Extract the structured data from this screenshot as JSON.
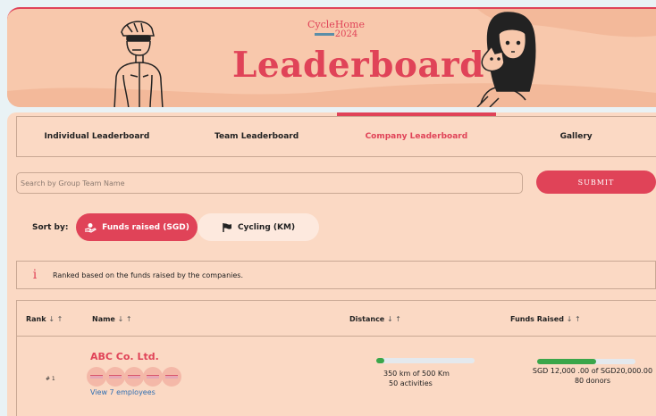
{
  "banner": {
    "logo_brand_a": "Cycle",
    "logo_brand_b": "Home",
    "logo_year": "2024",
    "title": "Leaderboard"
  },
  "tabs": [
    {
      "label": "Individual Leaderboard",
      "active": false
    },
    {
      "label": "Team Leaderboard",
      "active": false
    },
    {
      "label": "Company Leaderboard",
      "active": true
    },
    {
      "label": "Gallery",
      "active": false
    }
  ],
  "search": {
    "placeholder": "Search by Group Team Name",
    "submit_label": "SUBMIT"
  },
  "sort": {
    "label": "Sort by:",
    "options": [
      {
        "label": "Funds raised (SGD)",
        "icon": "donation-icon",
        "active": true
      },
      {
        "label": "Cycling (KM)",
        "icon": "flag-icon",
        "active": false
      }
    ]
  },
  "info": {
    "icon": "i",
    "text": "Ranked based on the funds raised by the companies."
  },
  "table": {
    "headers": {
      "rank": "Rank",
      "name": "Name",
      "distance": "Distance",
      "funds": "Funds Raised",
      "sort_arrows": "↓ ↑"
    },
    "rows": [
      {
        "rank": "# 1",
        "name": "ABC Co. Ltd.",
        "view_employees": "View 7 employees",
        "distance_line1": "350 km of 500 Km",
        "distance_line2": "50 activities",
        "distance_progress": 0.08,
        "funds_line1": "SGD 12,000 .00 of SGD20,000.00",
        "funds_line2": "80 donors",
        "funds_progress": 0.6
      }
    ]
  },
  "colors": {
    "accent": "#e04358",
    "panel": "#fbd9c4",
    "banner": "#f8c8ac",
    "progress": "#3aa64a"
  }
}
